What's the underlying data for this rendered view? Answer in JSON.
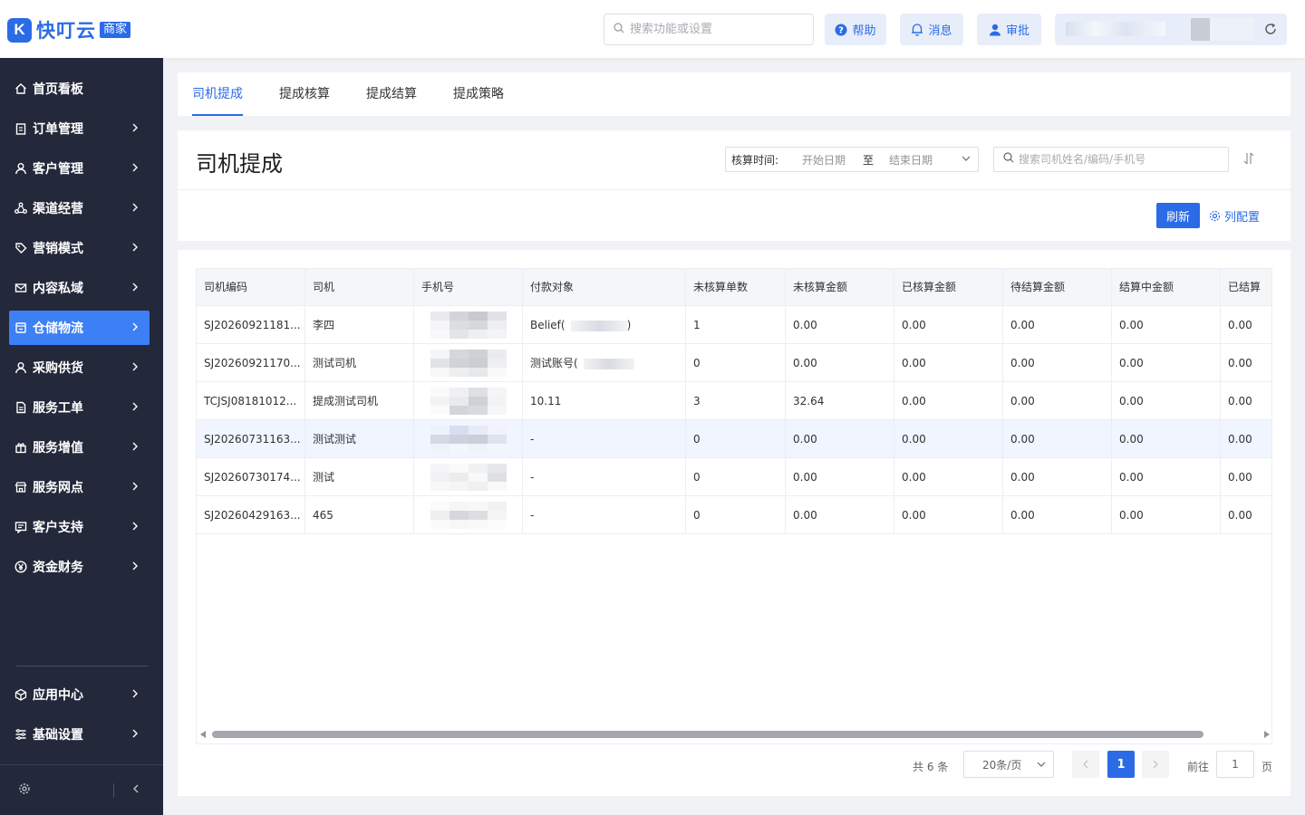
{
  "app": {
    "logo_mark": "K",
    "logo_text": "快叮云",
    "logo_badge": "商家"
  },
  "topbar": {
    "search_placeholder": "搜索功能或设置",
    "help": "帮助",
    "messages": "消息",
    "approval": "审批"
  },
  "sidebar": {
    "items": [
      {
        "label": "首页看板",
        "icon": "home-icon"
      },
      {
        "label": "订单管理",
        "icon": "clipboard-icon"
      },
      {
        "label": "客户管理",
        "icon": "user-icon"
      },
      {
        "label": "渠道经营",
        "icon": "network-icon"
      },
      {
        "label": "营销模式",
        "icon": "tag-icon"
      },
      {
        "label": "内容私域",
        "icon": "mail-icon"
      },
      {
        "label": "仓储物流",
        "icon": "warehouse-icon"
      },
      {
        "label": "采购供货",
        "icon": "user-icon"
      },
      {
        "label": "服务工单",
        "icon": "document-icon"
      },
      {
        "label": "服务增值",
        "icon": "gift-icon"
      },
      {
        "label": "服务网点",
        "icon": "store-icon"
      },
      {
        "label": "客户支持",
        "icon": "chat-icon"
      },
      {
        "label": "资金财务",
        "icon": "yen-icon"
      }
    ],
    "bottom_items": [
      {
        "label": "应用中心",
        "icon": "cube-icon"
      },
      {
        "label": "基础设置",
        "icon": "settings-list-icon"
      }
    ],
    "active_index": 6
  },
  "tabs": [
    {
      "label": "司机提成",
      "active": true
    },
    {
      "label": "提成核算",
      "active": false
    },
    {
      "label": "提成结算",
      "active": false
    },
    {
      "label": "提成策略",
      "active": false
    }
  ],
  "header": {
    "title": "司机提成",
    "date_label": "核算时间:",
    "start_date_placeholder": "开始日期",
    "date_separator": "至",
    "end_date_placeholder": "结束日期",
    "search_placeholder": "搜索司机姓名/编码/手机号",
    "refresh": "刷新",
    "column_config": "列配置"
  },
  "table": {
    "columns": [
      "司机编码",
      "司机",
      "手机号",
      "付款对象",
      "未核算单数",
      "未核算金额",
      "已核算金额",
      "待结算金额",
      "结算中金额",
      "已结算"
    ],
    "rows": [
      [
        "SJ20260921181...",
        "李四",
        "",
        "Belief(",
        "1",
        "0.00",
        "0.00",
        "0.00",
        "0.00",
        "0.00"
      ],
      [
        "SJ20260921170...",
        "测试司机",
        "",
        "测试账号(",
        "0",
        "0.00",
        "0.00",
        "0.00",
        "0.00",
        "0.00"
      ],
      [
        "TCJSJ08181012...",
        "提成测试司机",
        "",
        "10.11",
        "3",
        "32.64",
        "0.00",
        "0.00",
        "0.00",
        "0.00"
      ],
      [
        "SJ20260731163...",
        "测试测试",
        "",
        "-",
        "0",
        "0.00",
        "0.00",
        "0.00",
        "0.00",
        "0.00"
      ],
      [
        "SJ20260730174...",
        "测试",
        "",
        "-",
        "0",
        "0.00",
        "0.00",
        "0.00",
        "0.00",
        "0.00"
      ],
      [
        "SJ20260429163...",
        "465",
        "",
        "-",
        "0",
        "0.00",
        "0.00",
        "0.00",
        "0.00",
        "0.00"
      ]
    ],
    "hover_row": 3
  },
  "pagination": {
    "total": "共 6 条",
    "page_size": "20条/页",
    "current_page": "1",
    "goto_label": "前往",
    "goto_value": "1",
    "page_suffix": "页"
  },
  "colors": {
    "accent": "#2b6be6",
    "sidebar_bg": "#23283a",
    "sidebar_active": "#3d7ff5",
    "page_bg": "#f0f2f5"
  }
}
